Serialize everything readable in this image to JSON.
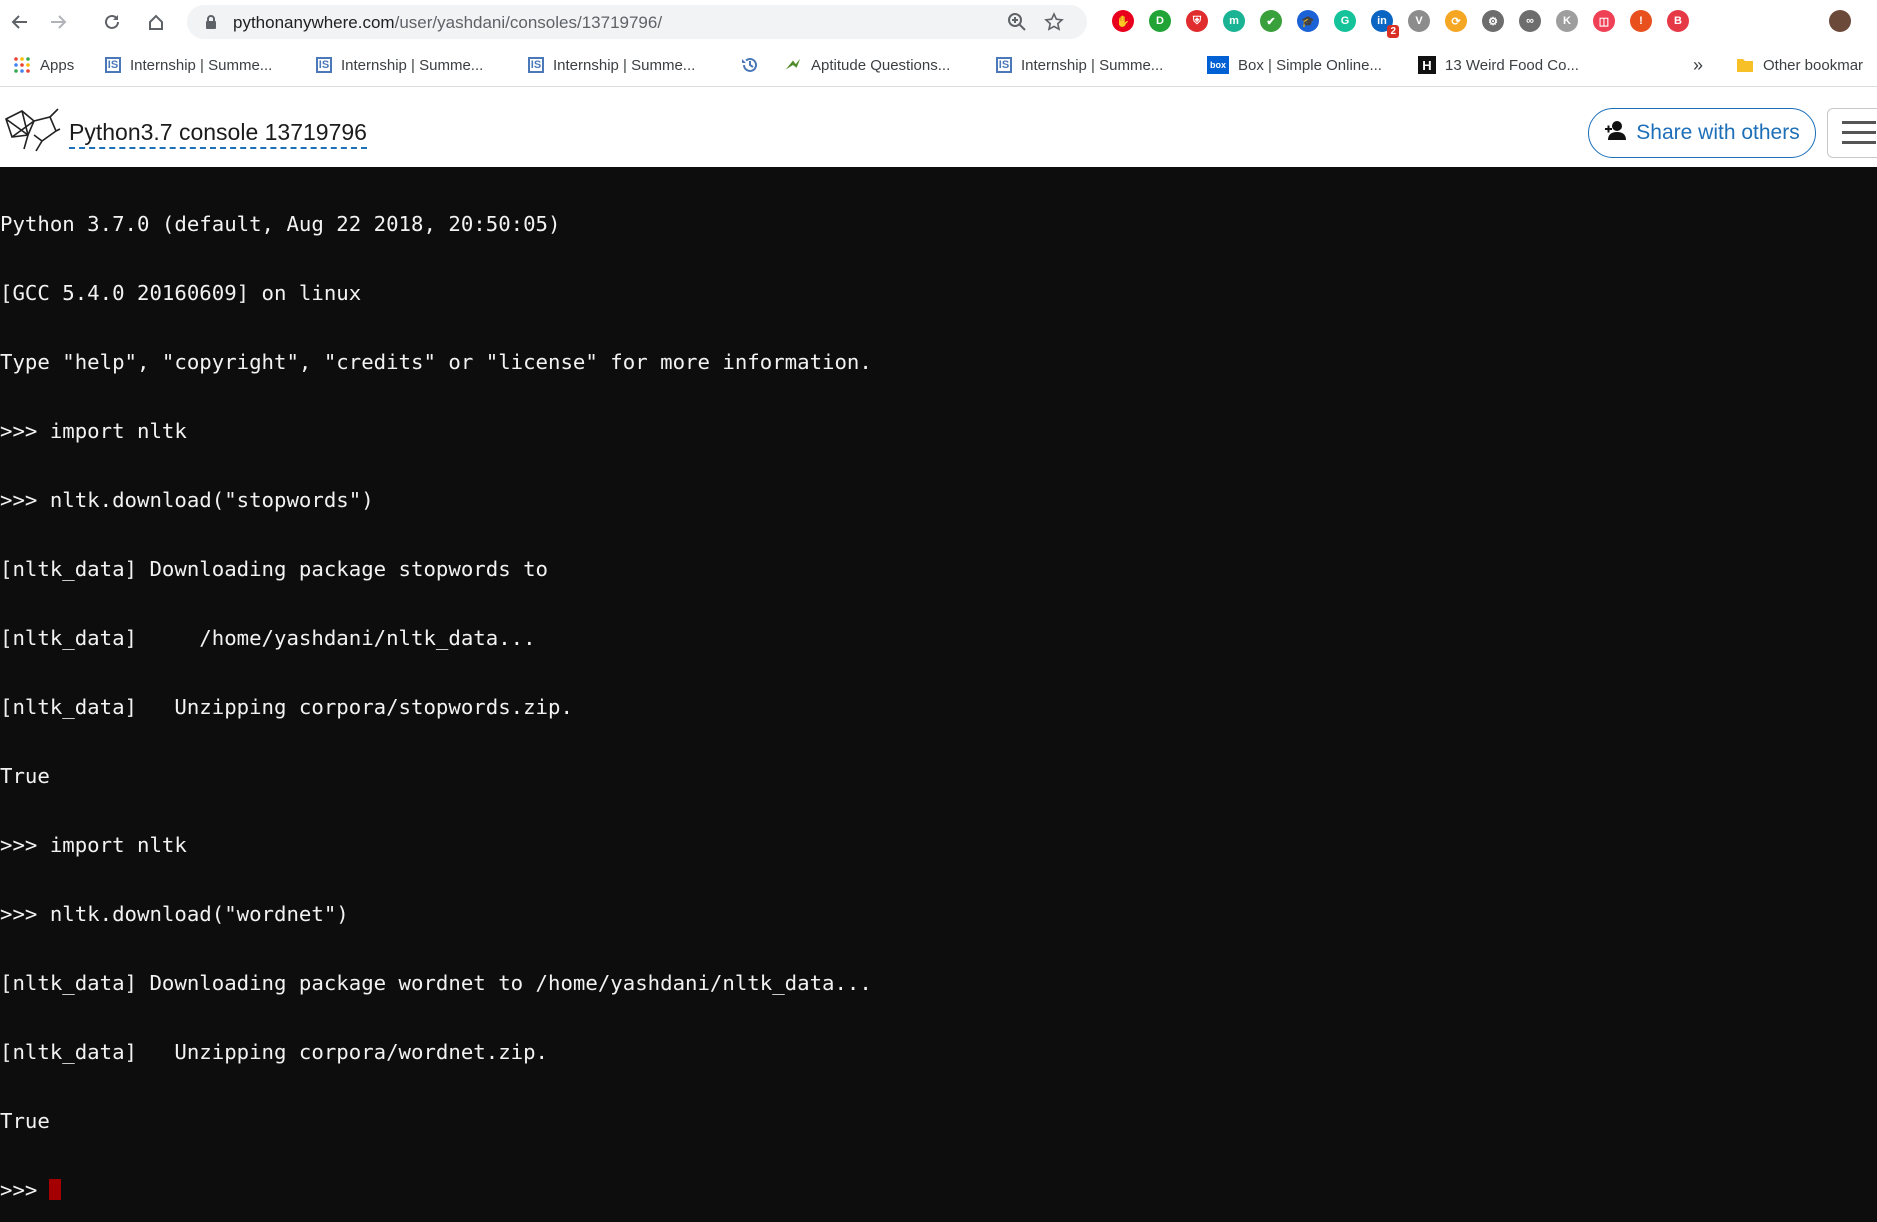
{
  "browser": {
    "url_host": "pythonanywhere.com",
    "url_path": "/user/yashdani/consoles/13719796/",
    "extensions": [
      {
        "name": "adblock-icon",
        "color": "#e8001c",
        "glyph": "✋"
      },
      {
        "name": "extension-d-icon",
        "color": "#21a336",
        "glyph": "D"
      },
      {
        "name": "shield-extension-icon",
        "color": "#e02c2c",
        "glyph": "⛨"
      },
      {
        "name": "extension-m-icon",
        "color": "#1ab394",
        "glyph": "m"
      },
      {
        "name": "checklist-extension-icon",
        "color": "#39a03b",
        "glyph": "✔"
      },
      {
        "name": "graduation-cap-icon",
        "color": "#1a62d6",
        "glyph": "🎓"
      },
      {
        "name": "grammarly-icon",
        "color": "#15c39a",
        "glyph": "G"
      },
      {
        "name": "linkedin-icon",
        "color": "#0a66c2",
        "glyph": "in",
        "badge": "2"
      },
      {
        "name": "vimeo-extension-icon",
        "color": "#8c8c8c",
        "glyph": "V"
      },
      {
        "name": "sync-extension-icon",
        "color": "#f5a623",
        "glyph": "⟳"
      },
      {
        "name": "bike-extension-icon",
        "color": "#6d6d6d",
        "glyph": "⚙"
      },
      {
        "name": "infinity-icon",
        "color": "#6d6d6d",
        "glyph": "∞"
      },
      {
        "name": "extension-k-icon",
        "color": "#9e9e9e",
        "glyph": "K"
      },
      {
        "name": "pocket-icon",
        "color": "#ef4056",
        "glyph": "◫"
      },
      {
        "name": "alert-extension-icon",
        "color": "#e8501e",
        "glyph": "!"
      },
      {
        "name": "extension-b-icon",
        "color": "#e63946",
        "glyph": "B"
      }
    ]
  },
  "bookmarks": [
    {
      "label": "Apps",
      "icon": "apps-grid-icon"
    },
    {
      "label": "Internship | Summe...",
      "icon": "internshala-icon"
    },
    {
      "label": "Internship | Summe...",
      "icon": "internshala-icon"
    },
    {
      "label": "Internship | Summe...",
      "icon": "internshala-icon"
    },
    {
      "label": "",
      "icon": "history-icon"
    },
    {
      "label": "Aptitude Questions...",
      "icon": "bird-icon"
    },
    {
      "label": "Internship | Summe...",
      "icon": "internshala-icon"
    },
    {
      "label": "Box | Simple Online...",
      "icon": "box-icon"
    },
    {
      "label": "13 Weird Food Co...",
      "icon": "h-icon"
    }
  ],
  "bookmarks_more": "»",
  "bookmarks_other": "Other bookmar",
  "header": {
    "title": "Python3.7 console 13719796",
    "share_label": "Share with others"
  },
  "console": {
    "lines": [
      "Python 3.7.0 (default, Aug 22 2018, 20:50:05)",
      "[GCC 5.4.0 20160609] on linux",
      "Type \"help\", \"copyright\", \"credits\" or \"license\" for more information.",
      ">>> import nltk",
      ">>> nltk.download(\"stopwords\")",
      "[nltk_data] Downloading package stopwords to",
      "[nltk_data]     /home/yashdani/nltk_data...",
      "[nltk_data]   Unzipping corpora/stopwords.zip.",
      "True",
      ">>> import nltk",
      ">>> nltk.download(\"wordnet\")",
      "[nltk_data] Downloading package wordnet to /home/yashdani/nltk_data...",
      "[nltk_data]   Unzipping corpora/wordnet.zip.",
      "True"
    ],
    "prompt": ">>>"
  },
  "colors": {
    "console_bg": "#0d0d0d",
    "console_text": "#f2f2f2",
    "cursor": "#a40000",
    "accent": "#1d6fb8"
  }
}
